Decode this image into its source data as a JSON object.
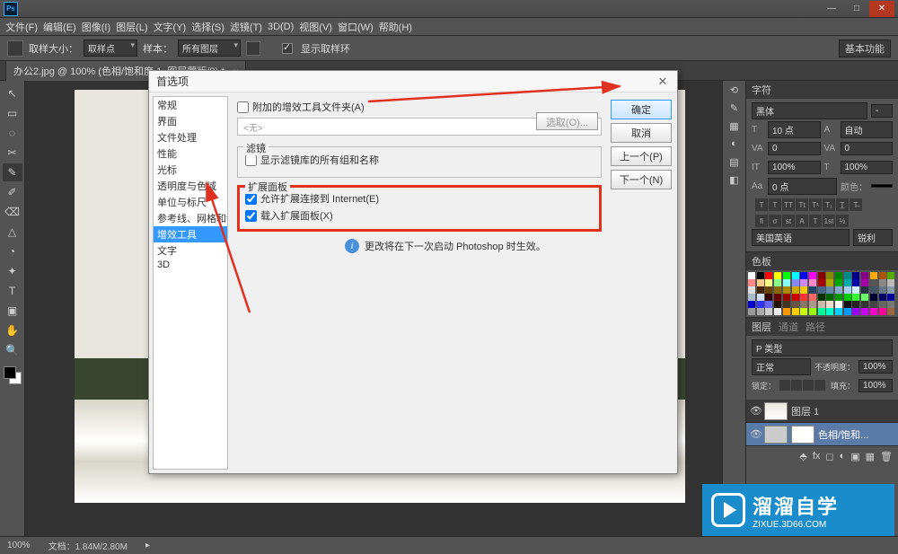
{
  "app": {
    "logo": "Ps"
  },
  "window_controls": {
    "min": "—",
    "max": "□",
    "close": "✕"
  },
  "menubar": [
    "文件(F)",
    "编辑(E)",
    "图像(I)",
    "图层(L)",
    "文字(Y)",
    "选择(S)",
    "滤镜(T)",
    "3D(D)",
    "视图(V)",
    "窗口(W)",
    "帮助(H)"
  ],
  "optbar": {
    "sample_size_label": "取样大小：",
    "sample_size_value": "取样点",
    "sample_label": "样本：",
    "sample_value": "所有图层",
    "show_ring": "显示取样环",
    "basic": "基本功能"
  },
  "doc_tab": {
    "title": "办公2.jpg @ 100% (色相/饱和度 1, 图层蒙版/8) *"
  },
  "tools": [
    "↖",
    "▭",
    "◌",
    "✂",
    "✎",
    "✐",
    "⌫",
    "△",
    "◔",
    "✦",
    "T",
    "▣",
    "✋",
    "🔍"
  ],
  "char_panel": {
    "tab": "字符",
    "font": "黑体",
    "style": "-",
    "size_lbl": "T",
    "size": "10 点",
    "leading_lbl": "A",
    "leading": "自动",
    "va": "VA",
    "va_v": "0",
    "va2": "VA",
    "va2_v": "0",
    "scale_lbl": "IT",
    "scale": "100%",
    "scale2_lbl": "T",
    "scale2": "100%",
    "baseline_lbl": "Aa",
    "baseline": "0 点",
    "color_lbl": "颜色：",
    "lang": "美国英语",
    "sharp": "锐利"
  },
  "swatch_panel": {
    "tab": "色板"
  },
  "layers_panel": {
    "tabs": [
      "图层",
      "通道",
      "路径"
    ],
    "kind": "P 类型",
    "blend": "正常",
    "opacity_lbl": "不透明度：",
    "opacity": "100%",
    "lock_lbl": "锁定：",
    "fill_lbl": "填充：",
    "fill": "100%",
    "layers": [
      {
        "name": "图层 1",
        "sel": false
      },
      {
        "name": "色相/饱和...",
        "sel": true
      }
    ]
  },
  "dialog": {
    "title": "首选项",
    "side": [
      "常规",
      "界面",
      "文件处理",
      "性能",
      "光标",
      "透明度与色域",
      "单位与标尺",
      "参考线、网格和切片",
      "增效工具",
      "文字",
      "3D"
    ],
    "side_selected": 8,
    "buttons": {
      "ok": "确定",
      "cancel": "取消",
      "prev": "上一个(P)",
      "next": "下一个(N)"
    },
    "addl_folder_chk": "附加的增效工具文件夹(A)",
    "addl_folder_placeholder": "<无>",
    "select_btn": "选取(O)...",
    "filters_legend": "滤镜",
    "filters_chk": "显示滤镜库的所有组和名称",
    "ext_legend": "扩展面板",
    "ext_chk1": "允许扩展连接到 Internet(E)",
    "ext_chk2": "载入扩展面板(X)",
    "info": "更改将在下一次启动 Photoshop 时生效。"
  },
  "watermark": {
    "brand": "溜溜自学",
    "site": "ZIXUE.3D66.COM"
  },
  "status": {
    "zoom": "100%",
    "doc": "文档：1.84M/2.80M"
  }
}
